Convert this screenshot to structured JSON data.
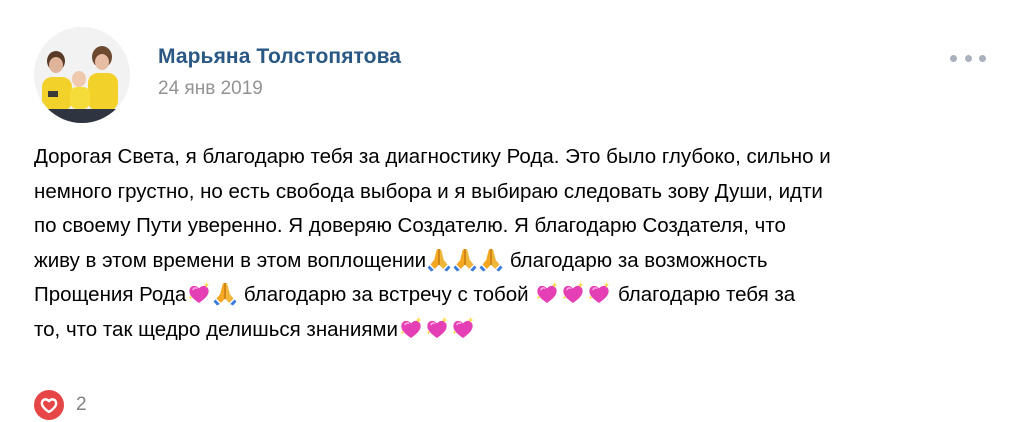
{
  "post": {
    "author": "Марьяна Толстопятова",
    "date": "24 янв 2019",
    "lines": [
      [
        {
          "t": "Дорогая Света, я благодарю тебя за диагностику Рода. Это было глубоко, сильно и"
        }
      ],
      [
        {
          "t": "немного грустно, но есть свобода выбора и я выбираю следовать зову Души, идти"
        }
      ],
      [
        {
          "t": "по своему Пути уверенно. Я доверяю Создателю. Я благодарю Создателя, что"
        }
      ],
      [
        {
          "t": "живу в этом времени в этом воплощении"
        },
        {
          "e": "folded-hands-emoji"
        },
        {
          "e": "folded-hands-emoji"
        },
        {
          "e": "folded-hands-emoji"
        },
        {
          "t": " благодарю за возможность"
        }
      ],
      [
        {
          "t": "Прощения Рода"
        },
        {
          "e": "sparkling-heart-emoji"
        },
        {
          "e": "folded-hands-emoji"
        },
        {
          "t": " благодарю за встречу с тобой "
        },
        {
          "e": "sparkling-heart-emoji"
        },
        {
          "e": "sparkling-heart-emoji"
        },
        {
          "e": "sparkling-heart-emoji"
        },
        {
          "t": " благодарю тебя за"
        }
      ],
      [
        {
          "t": "то, что так щедро делишься знаниями"
        },
        {
          "e": "sparkling-heart-emoji"
        },
        {
          "e": "sparkling-heart-emoji"
        },
        {
          "e": "sparkling-heart-emoji"
        }
      ]
    ]
  },
  "likes": {
    "count": "2",
    "icon": "heart-icon",
    "color": "#e64646"
  },
  "icons": {
    "more": "more-dots-icon",
    "avatar": "avatar-photo"
  }
}
